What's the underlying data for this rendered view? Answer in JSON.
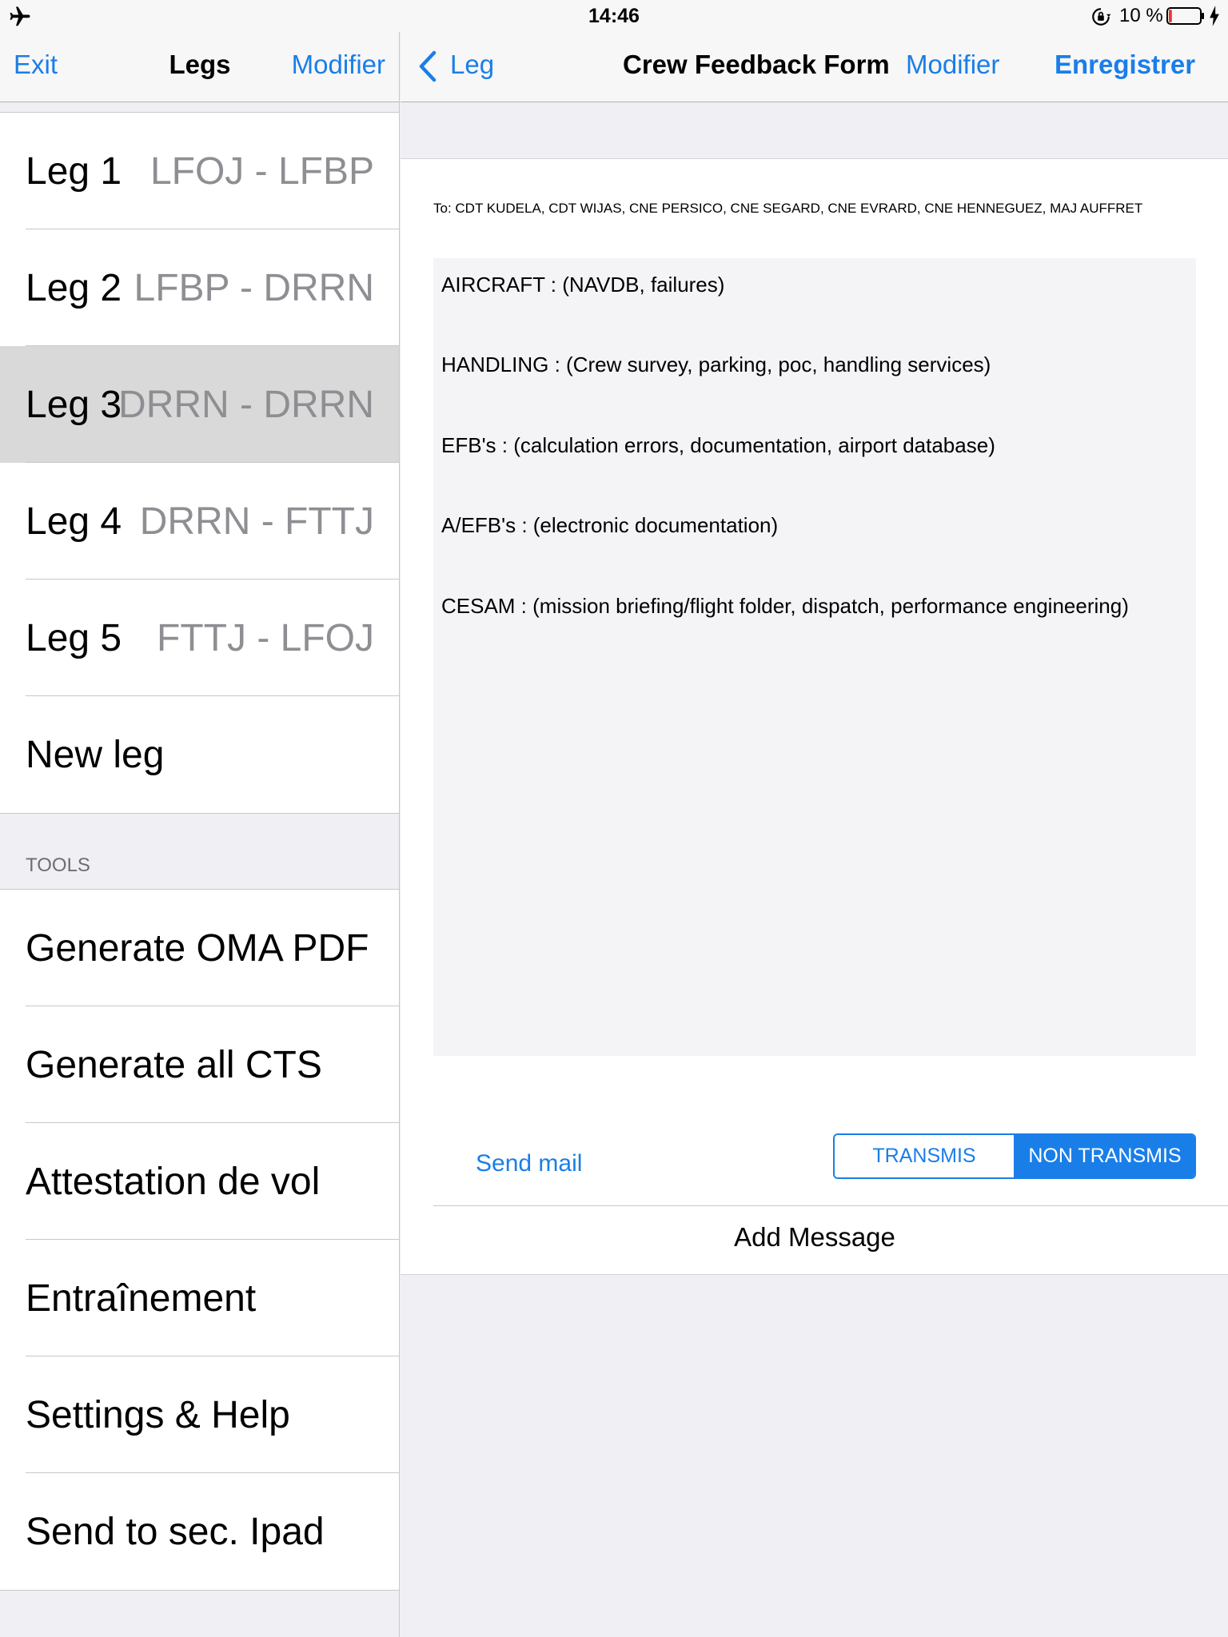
{
  "status_bar": {
    "time": "14:46",
    "battery_percent": "10 %",
    "battery_level": 0.1,
    "battery_color": "#e53935"
  },
  "colors": {
    "accent": "#1a7ee8",
    "selected_row": "#d9d9d9",
    "secondary_text": "#8e8e93"
  },
  "left_panel": {
    "nav": {
      "left_button": "Exit",
      "title": "Legs",
      "right_button": "Modifier"
    },
    "legs": [
      {
        "label": "Leg 1",
        "route": "LFOJ - LFBP"
      },
      {
        "label": "Leg 2",
        "route": "LFBP - DRRN"
      },
      {
        "label": "Leg 3",
        "route": "DRRN - DRRN"
      },
      {
        "label": "Leg 4",
        "route": "DRRN - FTTJ"
      },
      {
        "label": "Leg 5",
        "route": "FTTJ - LFOJ"
      }
    ],
    "new_leg": "New leg",
    "tools_header": "TOOLS",
    "tools": [
      "Generate OMA PDF",
      "Generate all CTS",
      "Attestation de vol",
      "Entraînement",
      "Settings & Help",
      "Send to sec. Ipad"
    ]
  },
  "right_panel": {
    "nav": {
      "back_label": "Leg",
      "title": "Crew Feedback Form",
      "modify": "Modifier",
      "save": "Enregistrer"
    },
    "to_line": "To: CDT KUDELA, CDT WIJAS, CNE PERSICO, CNE SEGARD, CNE EVRARD, CNE HENNEGUEZ, MAJ AUFFRET",
    "topics": [
      "AIRCRAFT : (NAVDB, failures)",
      "HANDLING : (Crew survey, parking, poc, handling services)",
      "EFB's : (calculation errors, documentation, airport database)",
      "A/EFB's : (electronic documentation)",
      "CESAM : (mission briefing/flight folder, dispatch, performance engineering)"
    ],
    "send_mail": "Send mail",
    "segment": {
      "option_1": "TRANSMIS",
      "option_2": "NON TRANSMIS"
    },
    "add_message": "Add Message"
  }
}
